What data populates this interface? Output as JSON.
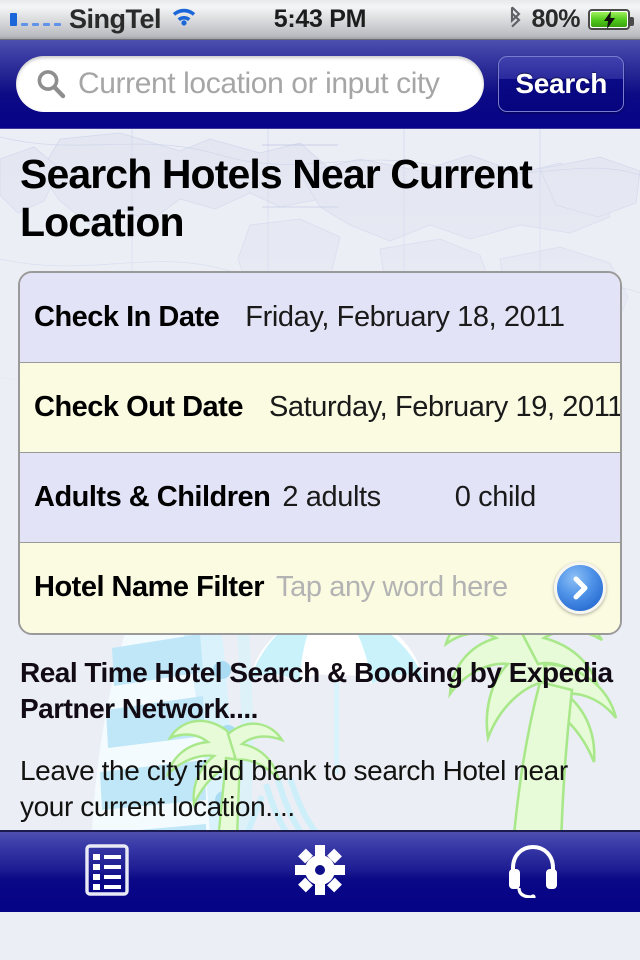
{
  "status_bar": {
    "carrier": "SingTel",
    "signal_icon": "signal-bars-icon",
    "wifi_icon": "wifi-icon",
    "time": "5:43 PM",
    "bluetooth_icon": "bluetooth-icon",
    "battery_percent": "80%",
    "battery_icon": "battery-charging-icon"
  },
  "nav": {
    "search_icon": "search-icon",
    "search_placeholder": "Current location or input city",
    "search_value": "",
    "search_button_label": "Search"
  },
  "page": {
    "title": "Search Hotels Near Current Location"
  },
  "form": {
    "rows": [
      {
        "label": "Check In Date",
        "value": "Friday, February 18, 2011",
        "secondary": ""
      },
      {
        "label": "Check Out Date",
        "value": "Saturday, February 19, 2011",
        "secondary": ""
      },
      {
        "label": "Adults & Children",
        "value": "2 adults",
        "secondary": "0 child"
      },
      {
        "label": "Hotel Name Filter",
        "value": "Tap any word here",
        "secondary": ""
      }
    ],
    "filter_placeholder": "Tap any word here",
    "go_button_icon": "chevron-right-circle-icon"
  },
  "copy": {
    "headline": "Real Time Hotel Search & Booking by Expedia Partner Network....",
    "body": "Leave the city field blank to search Hotel near your current location...."
  },
  "tabbar": {
    "items": [
      {
        "name": "list-icon",
        "label": ""
      },
      {
        "name": "gear-icon",
        "label": ""
      },
      {
        "name": "headset-icon",
        "label": ""
      }
    ]
  },
  "colors": {
    "nav_top": "#4e4fae",
    "nav_bottom": "#060488",
    "row_lavender": "#e3e3f7",
    "row_cream": "#fbfbe2",
    "accent_blue": "#2b6fd4",
    "page_bg": "#eceef6",
    "battery_green": "#4fc81a",
    "wifi_blue": "#1b66d8"
  }
}
